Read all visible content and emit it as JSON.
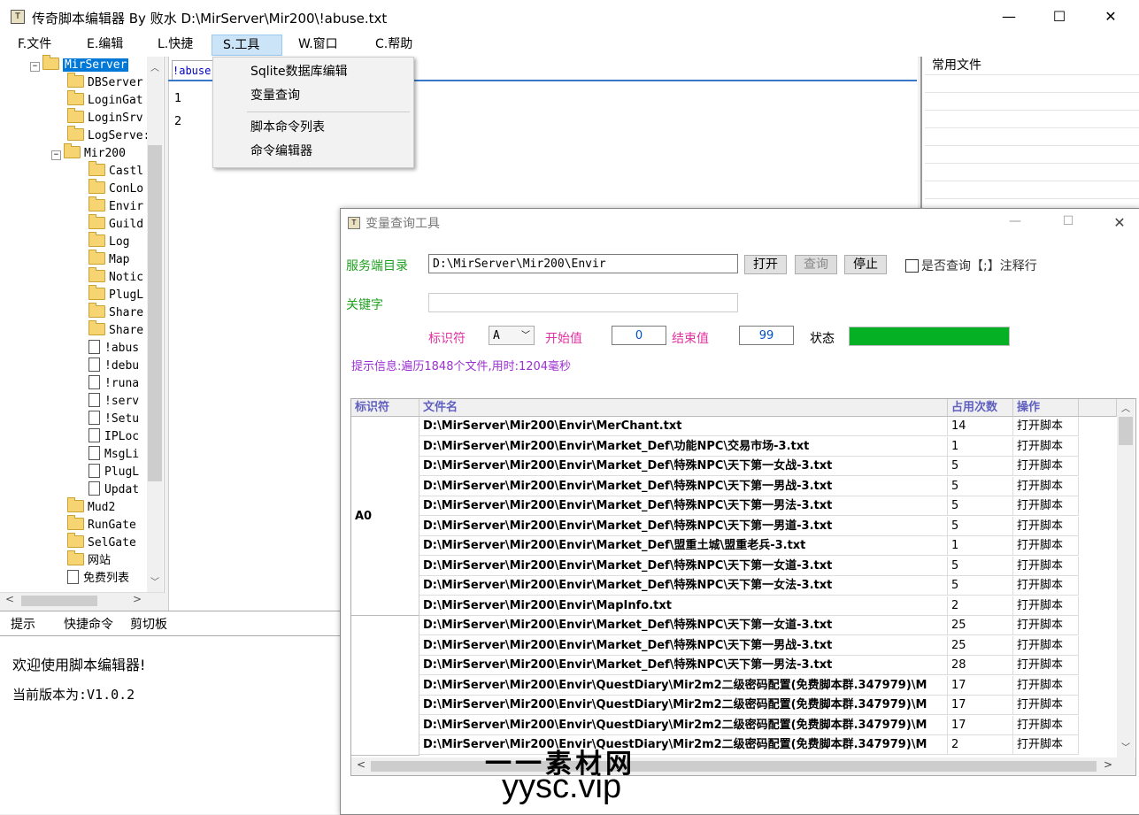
{
  "window": {
    "title": "传奇脚本编辑器  By  败水  D:\\MirServer\\Mir200\\!abuse.txt",
    "icon": "app-icon",
    "controls": [
      "—",
      "☐",
      "✕"
    ]
  },
  "menu": [
    "F.文件",
    "E.编辑",
    "L.快捷",
    "S.工具",
    "W.窗口",
    "C.帮助"
  ],
  "tools_menu": {
    "items": [
      "Sqlite数据库编辑",
      "变量查询",
      "脚本命令列表",
      "命令编辑器"
    ]
  },
  "tree": {
    "nodes": [
      {
        "label": "MirServer",
        "type": "folder",
        "expander": "−",
        "selected": true
      },
      {
        "label": "DBServer",
        "type": "folder"
      },
      {
        "label": "LoginGat",
        "type": "folder"
      },
      {
        "label": "LoginSrv",
        "type": "folder"
      },
      {
        "label": "LogServe:",
        "type": "folder"
      },
      {
        "label": "Mir200",
        "type": "folder",
        "expander": "−"
      },
      {
        "label": "Castl",
        "type": "folder"
      },
      {
        "label": "ConLo",
        "type": "folder"
      },
      {
        "label": "Envir",
        "type": "folder"
      },
      {
        "label": "Guild",
        "type": "folder"
      },
      {
        "label": "Log",
        "type": "folder"
      },
      {
        "label": "Map",
        "type": "folder"
      },
      {
        "label": "Notic",
        "type": "folder"
      },
      {
        "label": "PlugL",
        "type": "folder"
      },
      {
        "label": "Share",
        "type": "folder"
      },
      {
        "label": "Share",
        "type": "folder"
      },
      {
        "label": "!abus",
        "type": "file"
      },
      {
        "label": "!debu",
        "type": "file"
      },
      {
        "label": "!runa",
        "type": "file"
      },
      {
        "label": "!serv",
        "type": "file"
      },
      {
        "label": "!Setu",
        "type": "file"
      },
      {
        "label": "IPLoc",
        "type": "file"
      },
      {
        "label": "MsgLi",
        "type": "file"
      },
      {
        "label": "PlugL",
        "type": "file"
      },
      {
        "label": "Updat",
        "type": "file"
      },
      {
        "label": "Mud2",
        "type": "folder"
      },
      {
        "label": "RunGate",
        "type": "folder"
      },
      {
        "label": "SelGate",
        "type": "folder"
      },
      {
        "label": "网站",
        "type": "folder"
      },
      {
        "label": "免费列表",
        "type": "file"
      }
    ]
  },
  "editor": {
    "tab": "!abuse",
    "lines": [
      "1",
      "2"
    ]
  },
  "right_panel": {
    "title": "常用文件"
  },
  "bottom": {
    "tabs": [
      "提示",
      "快捷命令",
      "剪切板"
    ],
    "lines": [
      "欢迎使用脚本编辑器!",
      "当前版本为:V1.0.2"
    ]
  },
  "dialog": {
    "title": "变量查询工具",
    "controls": [
      "—",
      "☐",
      "✕"
    ],
    "server_dir_label": "服务端目录",
    "server_dir_value": "D:\\MirServer\\Mir200\\Envir",
    "btn_open": "打开",
    "btn_query": "查询",
    "btn_stop": "停止",
    "check_comment": "是否查询【;】注释行",
    "keyword_label": "关键字",
    "keyword_value": "",
    "id_label": "标识符",
    "id_value": "A",
    "start_label": "开始值",
    "start_value": "0",
    "end_label": "结束值",
    "end_value": "99",
    "status_label": "状态",
    "status_progress": 1.0,
    "hint": "提示信息:遍历1848个文件,用时:1204毫秒",
    "table": {
      "headers": [
        "标识符",
        "文件名",
        "占用次数",
        "操作"
      ],
      "groups": [
        {
          "id": "A0",
          "rows": [
            {
              "file": "D:\\MirServer\\Mir200\\Envir\\MerChant.txt",
              "count": "14",
              "op": "打开脚本"
            },
            {
              "file": "D:\\MirServer\\Mir200\\Envir\\Market_Def\\功能NPC\\交易市场-3.txt",
              "count": "1",
              "op": "打开脚本"
            },
            {
              "file": "D:\\MirServer\\Mir200\\Envir\\Market_Def\\特殊NPC\\天下第一女战-3.txt",
              "count": "5",
              "op": "打开脚本"
            },
            {
              "file": "D:\\MirServer\\Mir200\\Envir\\Market_Def\\特殊NPC\\天下第一男战-3.txt",
              "count": "5",
              "op": "打开脚本"
            },
            {
              "file": "D:\\MirServer\\Mir200\\Envir\\Market_Def\\特殊NPC\\天下第一男法-3.txt",
              "count": "5",
              "op": "打开脚本"
            },
            {
              "file": "D:\\MirServer\\Mir200\\Envir\\Market_Def\\特殊NPC\\天下第一男道-3.txt",
              "count": "5",
              "op": "打开脚本"
            },
            {
              "file": "D:\\MirServer\\Mir200\\Envir\\Market_Def\\盟重土城\\盟重老兵-3.txt",
              "count": "1",
              "op": "打开脚本"
            },
            {
              "file": "D:\\MirServer\\Mir200\\Envir\\Market_Def\\特殊NPC\\天下第一女道-3.txt",
              "count": "5",
              "op": "打开脚本"
            },
            {
              "file": "D:\\MirServer\\Mir200\\Envir\\Market_Def\\特殊NPC\\天下第一女法-3.txt",
              "count": "5",
              "op": "打开脚本"
            },
            {
              "file": "D:\\MirServer\\Mir200\\Envir\\MapInfo.txt",
              "count": "2",
              "op": "打开脚本"
            }
          ]
        },
        {
          "id": "",
          "rows": [
            {
              "file": "D:\\MirServer\\Mir200\\Envir\\Market_Def\\特殊NPC\\天下第一女道-3.txt",
              "count": "25",
              "op": "打开脚本"
            },
            {
              "file": "D:\\MirServer\\Mir200\\Envir\\Market_Def\\特殊NPC\\天下第一男战-3.txt",
              "count": "25",
              "op": "打开脚本"
            },
            {
              "file": "D:\\MirServer\\Mir200\\Envir\\Market_Def\\特殊NPC\\天下第一男法-3.txt",
              "count": "28",
              "op": "打开脚本"
            },
            {
              "file": "D:\\MirServer\\Mir200\\Envir\\QuestDiary\\Mir2m2二级密码配置(免费脚本群.347979)\\M",
              "count": "17",
              "op": "打开脚本"
            },
            {
              "file": "D:\\MirServer\\Mir200\\Envir\\QuestDiary\\Mir2m2二级密码配置(免费脚本群.347979)\\M",
              "count": "17",
              "op": "打开脚本"
            },
            {
              "file": "D:\\MirServer\\Mir200\\Envir\\QuestDiary\\Mir2m2二级密码配置(免费脚本群.347979)\\M",
              "count": "17",
              "op": "打开脚本"
            },
            {
              "file": "D:\\MirServer\\Mir200\\Envir\\QuestDiary\\Mir2m2二级密码配置(免费脚本群.347979)\\M",
              "count": "2",
              "op": "打开脚本"
            }
          ]
        }
      ]
    }
  },
  "watermark": {
    "line1": "一一素材网",
    "line2": "yysc.vip"
  }
}
